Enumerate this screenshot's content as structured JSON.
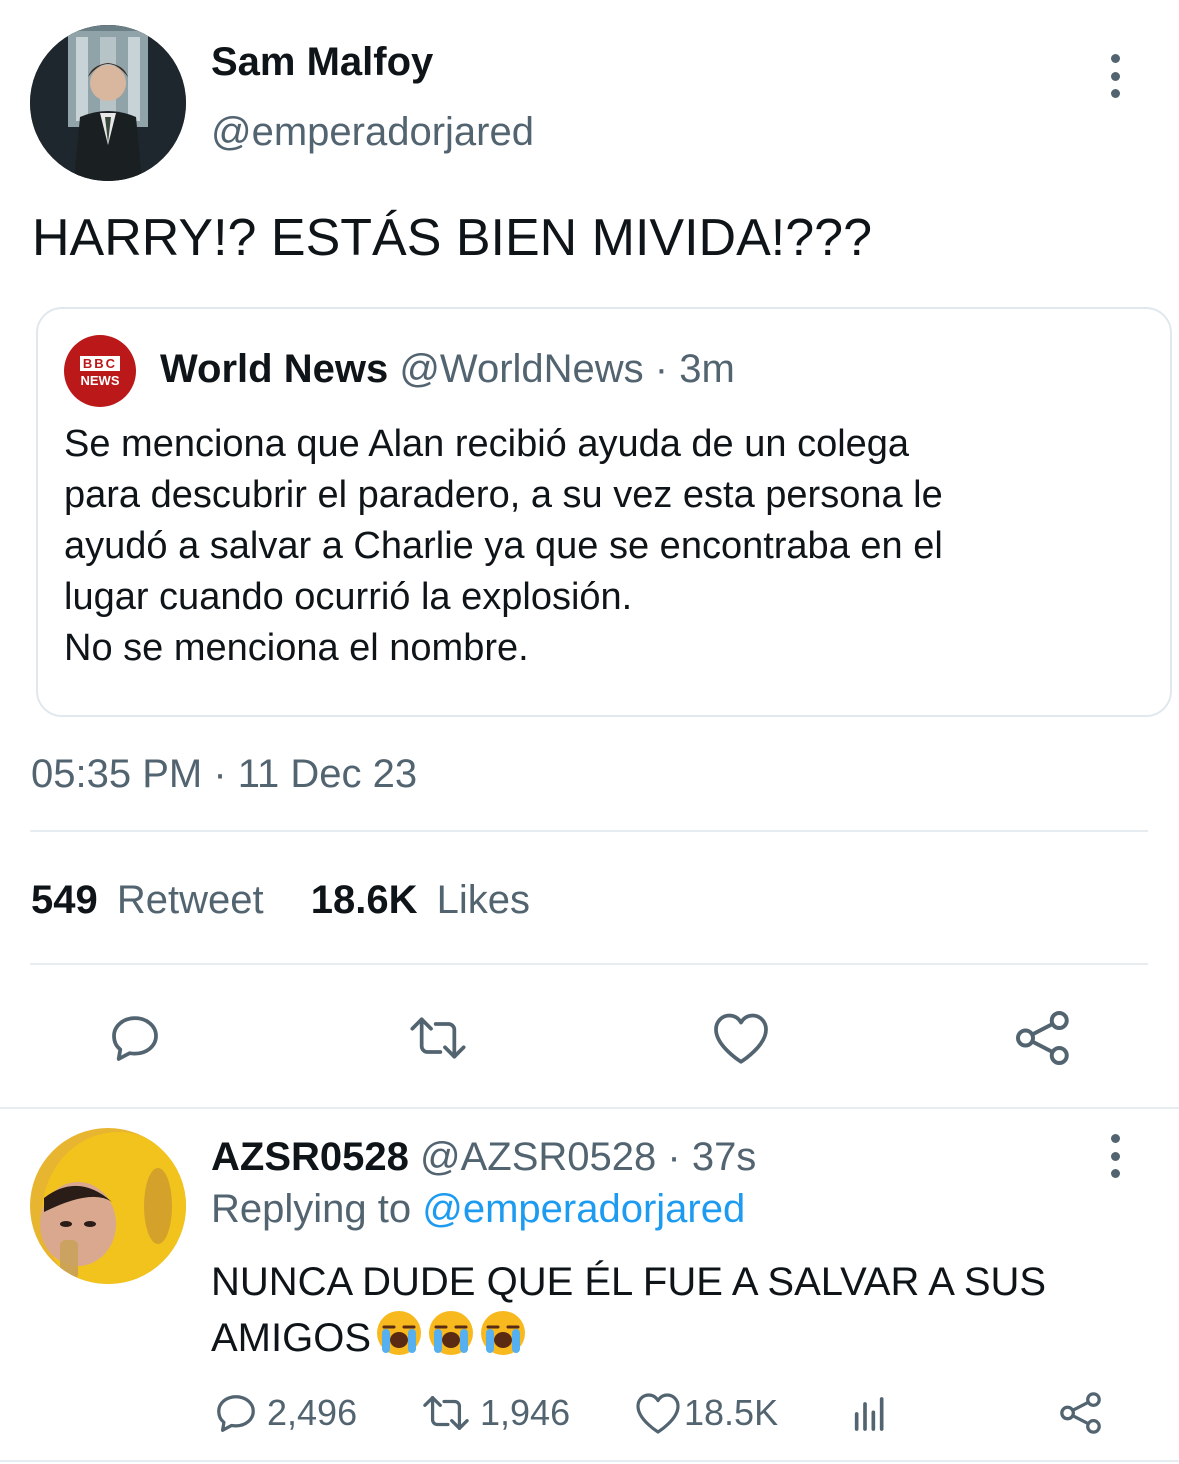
{
  "tweet": {
    "author_name": "Sam Malfoy",
    "author_handle": "@emperadorjared",
    "text": "HARRY!? ESTÁS BIEN MIVIDA!???",
    "timestamp": "05:35 PM · 11 Dec 23",
    "retweet_count": "549",
    "retweet_label": "Retweet",
    "likes_count": "18.6K",
    "likes_label": "Likes"
  },
  "quoted": {
    "logo_line1": "BBC",
    "logo_line2": "NEWS",
    "name": "World News",
    "handle_time": "@WorldNews · 3m",
    "lines": [
      "Se menciona que Alan recibió ayuda de un colega",
      "para descubrir el paradero, a su vez esta persona le",
      "ayudó a salvar a Charlie ya que se encontraba en el",
      "lugar cuando ocurrió la explosión.",
      "No se menciona el nombre."
    ]
  },
  "actions": [
    "reply-icon",
    "retweet-icon",
    "like-icon",
    "share-icon"
  ],
  "reply": {
    "name": "AZSR0528",
    "handle_time": "@AZSR0528 · 37s",
    "replying_prefix": "Replying to",
    "replying_handle": "@emperadorjared",
    "text_line1": "NUNCA DUDE QUE ÉL FUE A SALVAR A SUS",
    "text_line2": "AMIGOS",
    "emoji": "loudly-crying-face",
    "replies": "2,496",
    "retweets": "1,946",
    "likes": "18.5K"
  },
  "colors": {
    "text": "#0f1419",
    "muted": "#536471",
    "link": "#1d9bf0",
    "divider": "#e6ecf0",
    "bbc_red": "#bb1919"
  }
}
